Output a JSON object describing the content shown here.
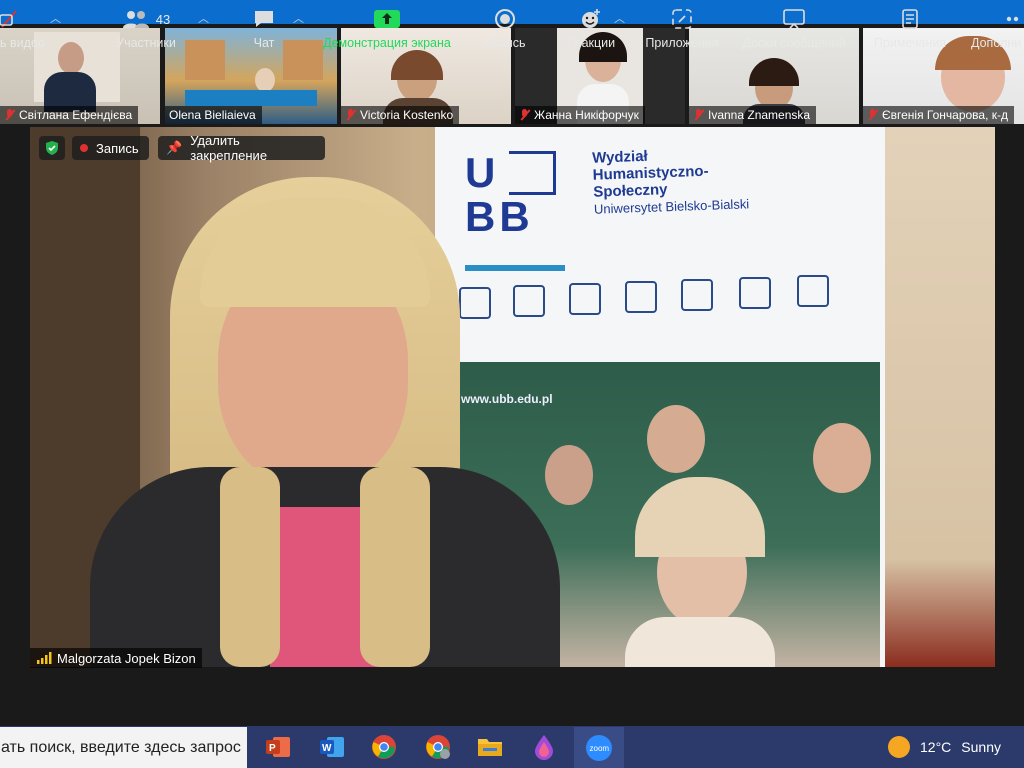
{
  "participants": [
    {
      "name": "Світлана Ефендієва",
      "muted": true
    },
    {
      "name": "Olena Bieliaieva",
      "muted": false
    },
    {
      "name": "Victoria Kostenko",
      "muted": true
    },
    {
      "name": "Жанна Никіфорчук",
      "muted": true
    },
    {
      "name": "Ivanna Znamenska",
      "muted": true
    },
    {
      "name": "Євгенія Гончарова, к-д",
      "muted": true
    }
  ],
  "overlay": {
    "record_label": "Запись",
    "unpin_label": "Удалить закрепление"
  },
  "banner": {
    "logo_top": "U",
    "logo_bottom": "BB",
    "line1": "Wydział",
    "line2": "Humanistyczno-",
    "line3": "Społeczny",
    "line4": "Uniwersytet Bielsko-Bialski",
    "url": "www.ubb.edu.pl"
  },
  "main_speaker": {
    "name": "Malgorzata Jopek Bizon"
  },
  "toolbar": {
    "video_label": "ь видео",
    "participants_label": "Участники",
    "participants_count": "43",
    "chat_label": "Чат",
    "share_label": "Демонстрация экрана",
    "record_label": "Запись",
    "reactions_label": "Реакции",
    "apps_label": "Приложения",
    "whiteboards_label": "Доски сообщений",
    "notes_label": "Примечания",
    "more_label": "Дополни"
  },
  "taskbar": {
    "search_text": "ать поиск, введите здесь запрос",
    "temperature": "12°C",
    "weather": "Sunny",
    "apps": [
      "powerpoint-icon",
      "word-icon",
      "chrome-icon",
      "chrome-profile-icon",
      "file-explorer-icon",
      "paint-icon",
      "zoom-icon"
    ]
  },
  "colors": {
    "accent": "#0b6ecf",
    "share_green": "#23d959",
    "record_red": "#e03131",
    "taskbar": "#2b3a6b"
  }
}
